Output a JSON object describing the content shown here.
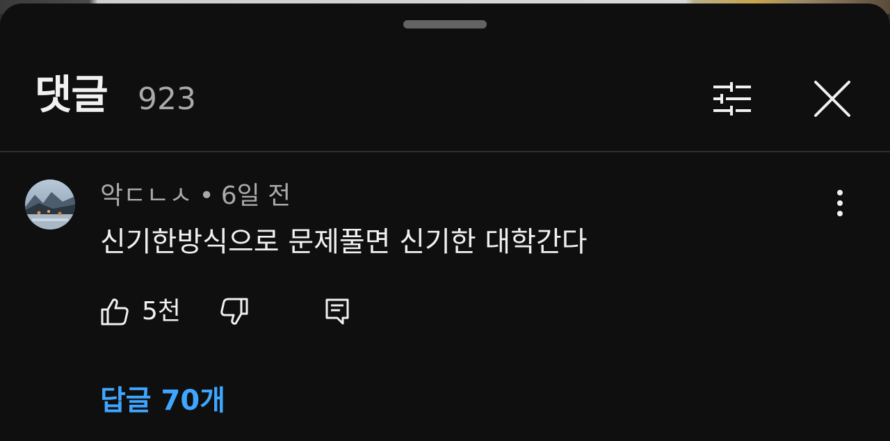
{
  "header": {
    "title": "댓글",
    "count": "923"
  },
  "icons": {
    "filter": "sliders-icon",
    "close": "close-icon",
    "more": "more-vert-icon",
    "like": "thumbs-up-icon",
    "dislike": "thumbs-down-icon",
    "reply": "comment-reply-icon"
  },
  "comment": {
    "author": "악ㄷㄴㅅ",
    "separator": "•",
    "time": "6일 전",
    "text": "신기한방식으로 문제풀면 신기한 대학간다",
    "likes": "5천",
    "replies_label": "답글 70개"
  },
  "colors": {
    "background": "#0f0f0f",
    "text_primary": "#f1f1f1",
    "text_secondary": "#aaaaaa",
    "link": "#3ea6ff"
  }
}
